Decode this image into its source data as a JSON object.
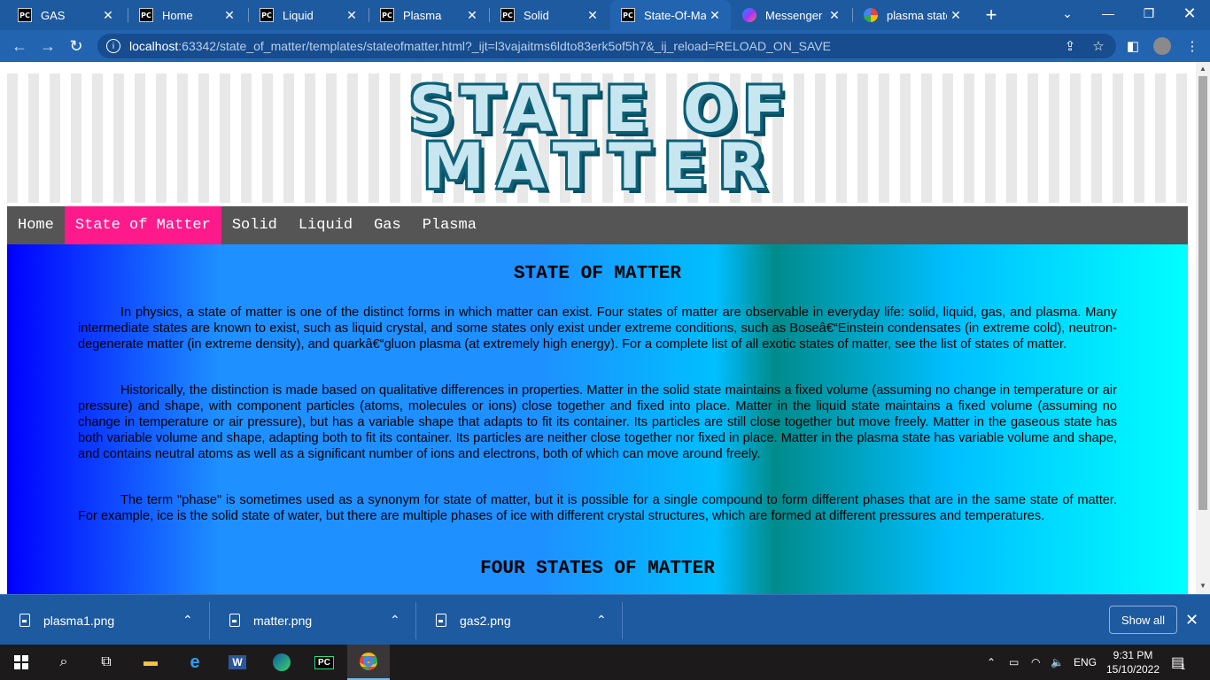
{
  "tabs": [
    {
      "title": "GAS",
      "icon": "pycharm-icon"
    },
    {
      "title": "Home",
      "icon": "pycharm-icon"
    },
    {
      "title": "Liquid",
      "icon": "pycharm-icon"
    },
    {
      "title": "Plasma",
      "icon": "pycharm-icon"
    },
    {
      "title": "Solid",
      "icon": "pycharm-icon"
    },
    {
      "title": "State-Of-Mat",
      "icon": "pycharm-icon"
    },
    {
      "title": "Messenger",
      "icon": "messenger-icon"
    },
    {
      "title": "plasma state",
      "icon": "google-icon"
    }
  ],
  "address": {
    "host": "localhost",
    "rest": ":63342/state_of_matter/templates/stateofmatter.html?_ijt=l3vajaitms6ldto83erk5of5h7&_ij_reload=RELOAD_ON_SAVE"
  },
  "page": {
    "banner_line1": "STATE OF",
    "banner_line2": "MATTER",
    "nav": [
      "Home",
      "State of Matter",
      "Solid",
      "Liquid",
      "Gas",
      "Plasma"
    ],
    "active_nav": "State of Matter",
    "heading": "STATE OF MATTER",
    "paragraphs": [
      "In physics, a state of matter is one of the distinct forms in which matter can exist. Four states of matter are observable in everyday life: solid, liquid, gas, and plasma. Many intermediate states are known to exist, such as liquid crystal, and some states only exist under extreme conditions, such as Boseâ€“Einstein condensates (in extreme cold), neutron-degenerate matter (in extreme density), and quarkâ€“gluon plasma (at extremely high energy). For a complete list of all exotic states of matter, see the list of states of matter.",
      "Historically, the distinction is made based on qualitative differences in properties. Matter in the solid state maintains a fixed volume (assuming no change in temperature or air pressure) and shape, with component particles (atoms, molecules or ions) close together and fixed into place. Matter in the liquid state maintains a fixed volume (assuming no change in temperature or air pressure), but has a variable shape that adapts to fit its container. Its particles are still close together but move freely. Matter in the gaseous state has both variable volume and shape, adapting both to fit its container. Its particles are neither close together nor fixed in place. Matter in the plasma state has variable volume and shape, and contains neutral atoms as well as a significant number of ions and electrons, both of which can move around freely.",
      "The term \"phase\" is sometimes used as a synonym for state of matter, but it is possible for a single compound to form different phases that are in the same state of matter. For example, ice is the solid state of water, but there are multiple phases of ice with different crystal structures, which are formed at different pressures and temperatures."
    ],
    "subheading": "FOUR STATES OF MATTER"
  },
  "downloads": {
    "files": [
      "plasma1.png",
      "matter.png",
      "gas2.png"
    ],
    "show_all": "Show all"
  },
  "taskbar": {
    "lang": "ENG",
    "time": "9:31 PM",
    "date": "15/10/2022",
    "notifications": "1"
  },
  "colors": {
    "nav_active": "#ff1a8c",
    "nav_bg": "#555555",
    "browser_frame": "#1e5aa0"
  }
}
